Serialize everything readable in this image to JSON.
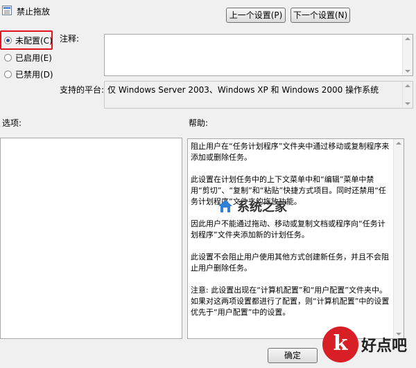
{
  "window": {
    "title": "禁止拖放"
  },
  "nav": {
    "prev_label": "上一个设置(P)",
    "next_label": "下一个设置(N)"
  },
  "radios": [
    {
      "label": "未配置(C)",
      "checked": true
    },
    {
      "label": "已启用(E)",
      "checked": false
    },
    {
      "label": "已禁用(D)",
      "checked": false
    }
  ],
  "comment": {
    "label": "注释:",
    "value": ""
  },
  "platform": {
    "label": "支持的平台:",
    "value": "仅 Windows Server 2003、Windows XP 和 Windows 2000 操作系统"
  },
  "options": {
    "label": "选项:"
  },
  "help": {
    "label": "帮助:",
    "paragraphs": [
      "阻止用户在“任务计划程序”文件夹中通过移动或复制程序来添加或删除任务。",
      "此设置在计划任务中的上下文菜单中和“编辑”菜单中禁用“剪切”、“复制”和“粘贴”快捷方式项目。同时还禁用“任务计划程序”文件夹的拖放功能。",
      "因此用户不能通过拖动、移动或复制文档或程序向“任务计划程序”文件夹添加新的计划任务。",
      "此设置不会阻止用户使用其他方式创建新任务，并且不会阻止用户删除任务。",
      "注意: 此设置出现在“计算机配置”和“用户配置”文件夹中。如果对这两项设置都进行了配置，则“计算机配置”中的设置优先于“用户配置”中的设置。"
    ]
  },
  "footer": {
    "ok_label": "确定"
  },
  "watermark": {
    "text": "系统之家"
  },
  "logo": {
    "glyph": "k",
    "text": "好点吧"
  },
  "colors": {
    "highlight": "#e0141c",
    "logo": "#d81f26"
  }
}
